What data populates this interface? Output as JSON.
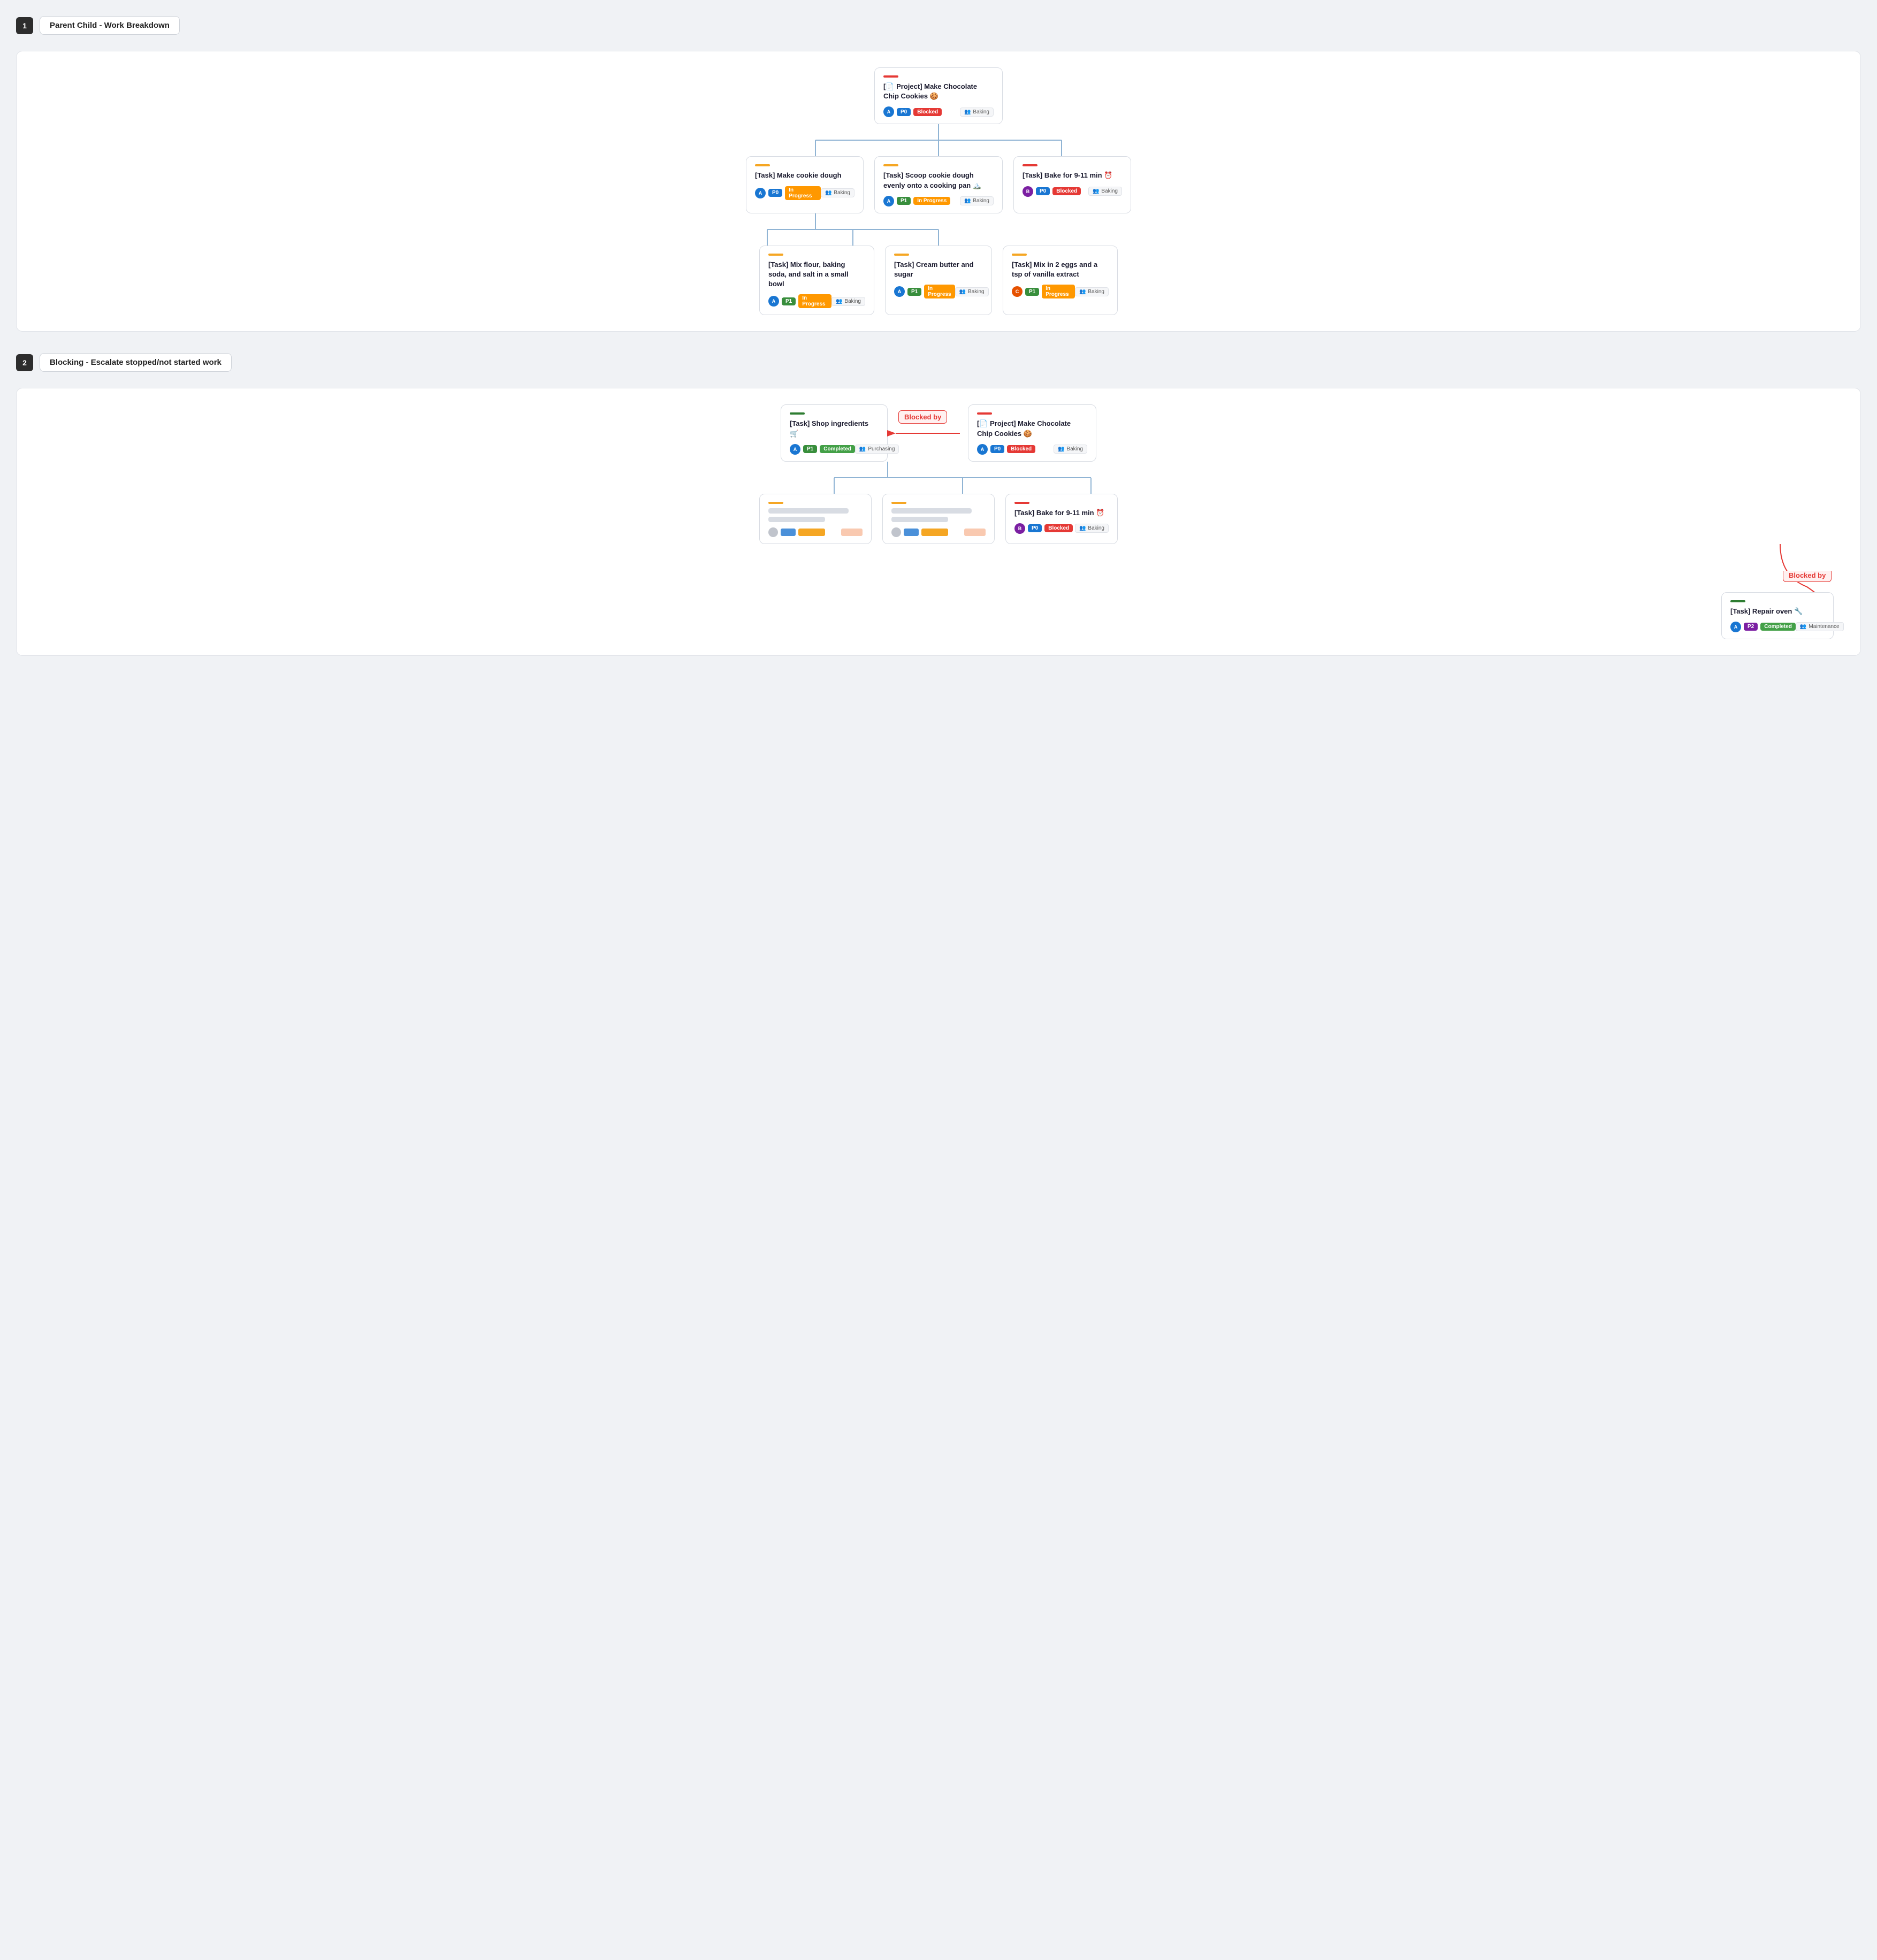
{
  "sections": [
    {
      "number": "1",
      "title": "Parent Child - Work Breakdown",
      "cards": {
        "root": {
          "accent": "accent-red",
          "title": "[📄 Project] Make Chocolate Chip Cookies 🍪",
          "avatar_color": "avatar-blue",
          "avatar_text": "A",
          "priority": "P0",
          "priority_class": "badge-p0",
          "status": "Blocked",
          "status_class": "badge-blocked",
          "team": "Baking",
          "team_icon": "👥"
        },
        "level1": [
          {
            "accent": "accent-orange",
            "title": "[Task] Make cookie dough",
            "avatar_color": "avatar-blue",
            "avatar_text": "A",
            "priority": "P0",
            "priority_class": "badge-p0",
            "status": "In Progress",
            "status_class": "badge-inprogress",
            "team": "Baking",
            "team_icon": "👥"
          },
          {
            "accent": "accent-orange",
            "title": "[Task] Scoop cookie dough evenly onto a cooking pan 🏔️",
            "avatar_color": "avatar-blue",
            "avatar_text": "A",
            "priority": "P1",
            "priority_class": "badge-p1",
            "status": "In Progress",
            "status_class": "badge-inprogress",
            "team": "Baking",
            "team_icon": "👥"
          },
          {
            "accent": "accent-red",
            "title": "[Task] Bake for 9-11 min ⏰",
            "avatar_color": "avatar-purple",
            "avatar_text": "B",
            "priority": "P0",
            "priority_class": "badge-p0",
            "status": "Blocked",
            "status_class": "badge-blocked",
            "team": "Baking",
            "team_icon": "👥"
          }
        ],
        "level2": [
          {
            "accent": "accent-orange",
            "title": "[Task] Mix flour, baking soda, and salt in a small bowl",
            "avatar_color": "avatar-blue",
            "avatar_text": "A",
            "priority": "P1",
            "priority_class": "badge-p1",
            "status": "In Progress",
            "status_class": "badge-inprogress",
            "team": "Baking",
            "team_icon": "👥"
          },
          {
            "accent": "accent-orange",
            "title": "[Task] Cream butter and sugar",
            "avatar_color": "avatar-blue",
            "avatar_text": "A",
            "priority": "P1",
            "priority_class": "badge-p1",
            "status": "In Progress",
            "status_class": "badge-inprogress",
            "team": "Baking",
            "team_icon": "👥"
          },
          {
            "accent": "accent-orange",
            "title": "[Task] Mix in 2 eggs and a tsp of vanilla extract",
            "avatar_color": "avatar-orange",
            "avatar_text": "C",
            "priority": "P1",
            "priority_class": "badge-p1",
            "status": "In Progress",
            "status_class": "badge-inprogress",
            "team": "Baking",
            "team_icon": "👥"
          }
        ]
      }
    },
    {
      "number": "2",
      "title": "Blocking - Escalate stopped/not started work",
      "blocked_by_label": "Blocked by",
      "cards": {
        "shop": {
          "accent": "accent-green",
          "title": "[Task] Shop ingredients 🛒",
          "avatar_color": "avatar-blue",
          "avatar_text": "A",
          "priority": "P1",
          "priority_class": "badge-p1",
          "status": "Completed",
          "status_class": "badge-completed",
          "team": "Purchasing",
          "team_icon": "👥"
        },
        "root": {
          "accent": "accent-red",
          "title": "[📄 Project] Make Chocolate Chip Cookies 🍪",
          "avatar_color": "avatar-blue",
          "avatar_text": "A",
          "priority": "P0",
          "priority_class": "badge-p0",
          "status": "Blocked",
          "status_class": "badge-blocked",
          "team": "Baking",
          "team_icon": "👥"
        },
        "bake": {
          "accent": "accent-red",
          "title": "[Task] Bake for 9-11 min ⏰",
          "avatar_color": "avatar-purple",
          "avatar_text": "B",
          "priority": "P0",
          "priority_class": "badge-p0",
          "status": "Blocked",
          "status_class": "badge-blocked",
          "team": "Baking",
          "team_icon": "👥"
        },
        "repair": {
          "accent": "accent-green",
          "title": "[Task] Repair oven 🔧",
          "avatar_color": "avatar-blue",
          "avatar_text": "A",
          "priority": "P2",
          "priority_class": "badge-p2",
          "status": "Completed",
          "status_class": "badge-completed",
          "team": "Maintenance",
          "team_icon": "👥"
        }
      }
    }
  ]
}
